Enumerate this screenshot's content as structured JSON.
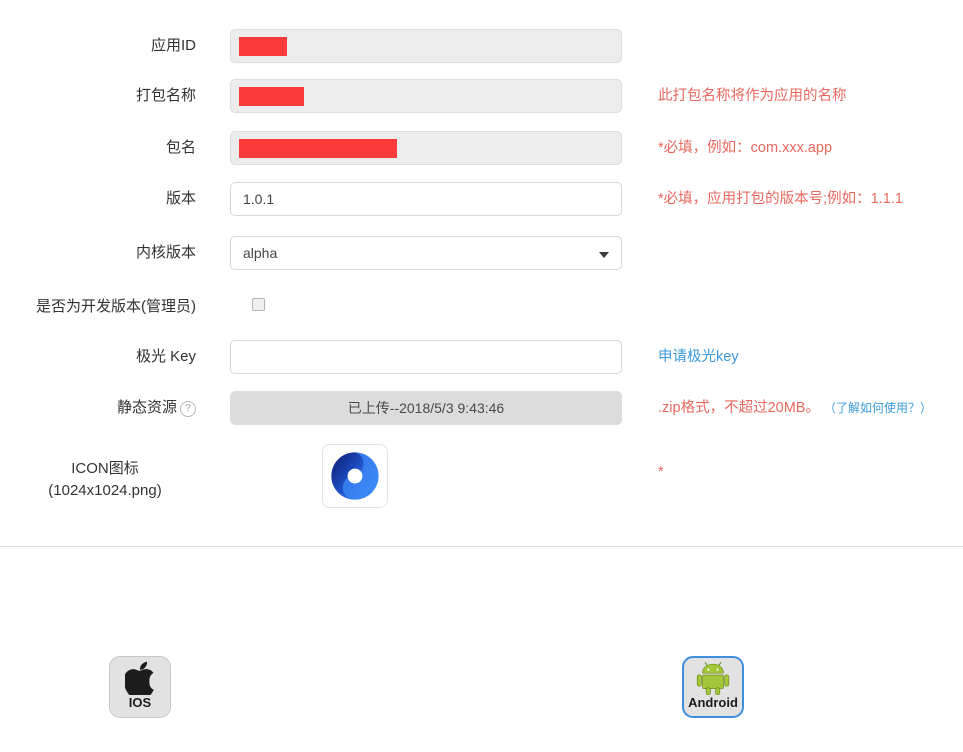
{
  "form": {
    "rows": [
      {
        "label": "应用ID",
        "type": "redacted",
        "redact_width": 48,
        "hint": "",
        "hint_type": "none"
      },
      {
        "label": "打包名称",
        "type": "redacted",
        "redact_width": 65,
        "hint": "此打包名称将作为应用的名称",
        "hint_type": "red"
      },
      {
        "label": "包名",
        "type": "redacted",
        "redact_width": 158,
        "hint": "*必填，例如：com.xxx.app",
        "hint_type": "red"
      },
      {
        "label": "版本",
        "type": "text",
        "value": "1.0.1",
        "hint": "*必填，应用打包的版本号;例如：1.1.1",
        "hint_type": "red"
      },
      {
        "label": "内核版本",
        "type": "select",
        "value": "alpha",
        "options": [
          "alpha"
        ],
        "hint": "",
        "hint_type": "none"
      },
      {
        "label": "是否为开发版本(管理员)",
        "type": "checkbox",
        "checked": false,
        "hint": "",
        "hint_type": "none"
      },
      {
        "label": "极光 Key",
        "type": "text",
        "value": "",
        "placeholder": "",
        "hint": "申请极光key",
        "hint_type": "link"
      }
    ],
    "static_resource": {
      "label": "静态资源",
      "help_icon": "question-circle-icon",
      "help_glyph": "?",
      "upload_label": "已上传--2018/5/3 9:43:46",
      "hint_red": ".zip格式，不超过20MB。",
      "hint_link": "（了解如何使用？）"
    },
    "icon_row": {
      "label_line1": "ICON图标",
      "label_line2": "(1024x1024.png)",
      "icon_name": "app-icon-preview",
      "required_mark": "*"
    }
  },
  "platforms": [
    {
      "id": "ios",
      "label": "IOS",
      "icon": "apple-icon",
      "selected": false
    },
    {
      "id": "android",
      "label": "Android",
      "icon": "android-icon",
      "selected": true
    }
  ],
  "colors": {
    "redaction": "#fb3b3b",
    "hint_red": "#e8685f",
    "link_blue": "#3d9ad9",
    "selected_border": "#3e8ede",
    "android_green": "#a4c639"
  }
}
